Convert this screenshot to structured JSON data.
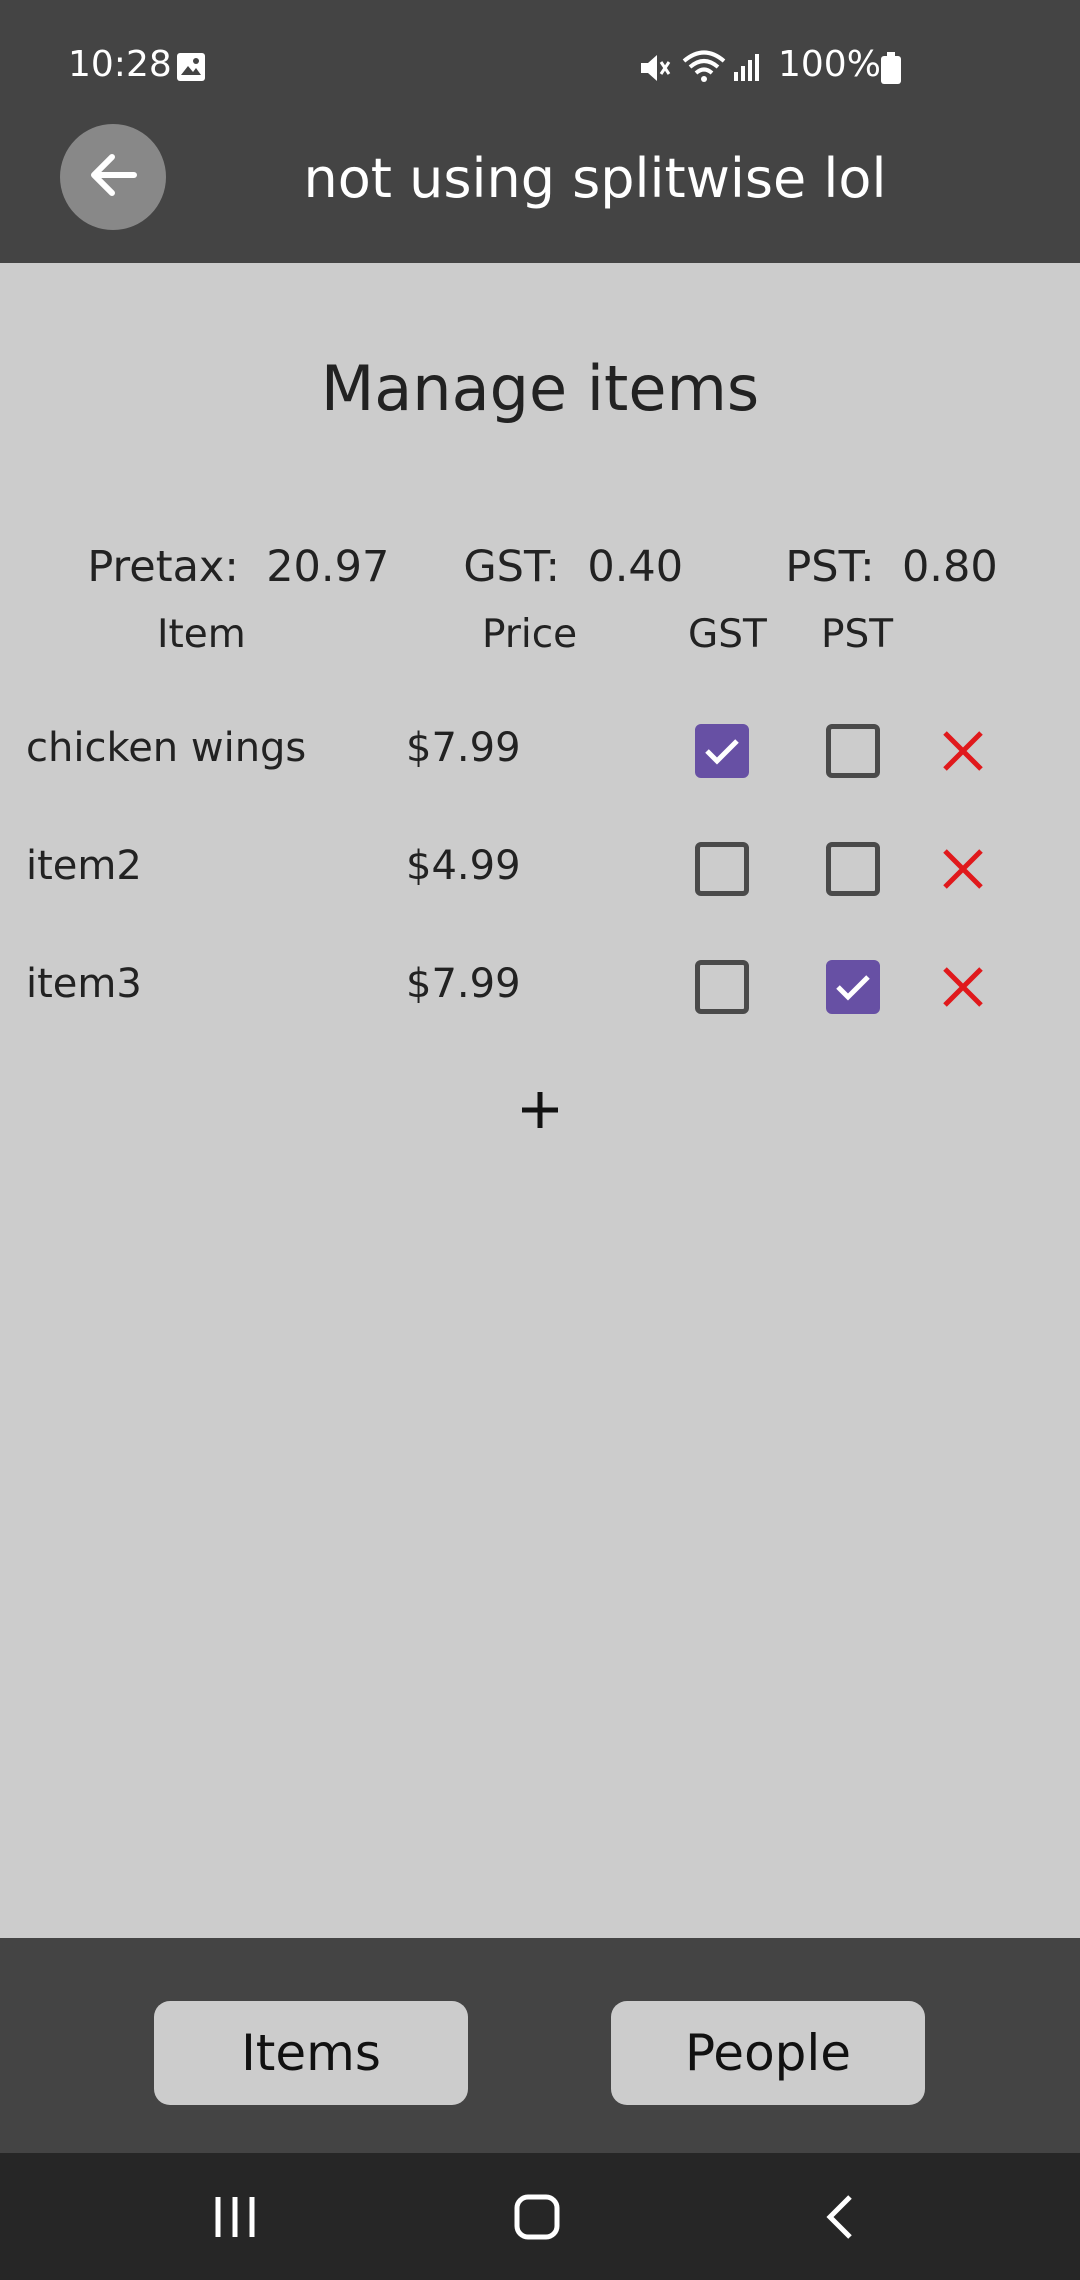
{
  "status": {
    "time": "10:28",
    "battery": "100%"
  },
  "app": {
    "title": "not using splitwise lol"
  },
  "page": {
    "title": "Manage items",
    "totals": {
      "pretax_label": "Pretax:",
      "pretax": "20.97",
      "gst_label": "GST:",
      "gst": "0.40",
      "pst_label": "PST:",
      "pst": "0.80"
    },
    "columns": {
      "item": "Item",
      "price": "Price",
      "gst": "GST",
      "pst": "PST"
    },
    "items": [
      {
        "name": "chicken wings",
        "price": "$7.99",
        "gst": true,
        "pst": false
      },
      {
        "name": "item2",
        "price": "$4.99",
        "gst": false,
        "pst": false
      },
      {
        "name": "item3",
        "price": "$7.99",
        "gst": false,
        "pst": true
      }
    ]
  },
  "tabs": {
    "items": "Items",
    "people": "People"
  },
  "colors": {
    "checkbox_checked": "#6750a4",
    "delete": "#e0191c",
    "bar": "#444444",
    "background": "#cccccc"
  },
  "icons": {
    "back": "arrow-left-icon",
    "add": "plus-icon",
    "delete": "close-icon",
    "recents": "recent-apps-icon",
    "home": "home-icon",
    "nav_back": "chevron-left-icon"
  }
}
